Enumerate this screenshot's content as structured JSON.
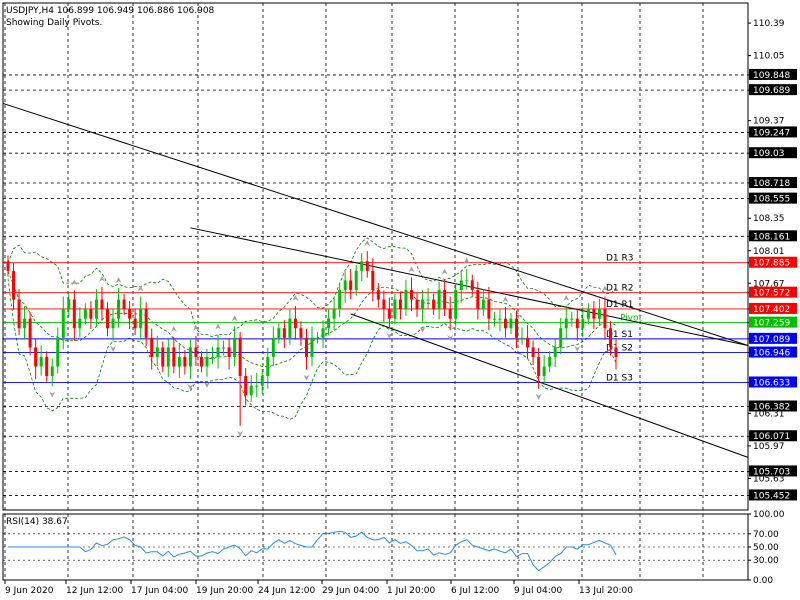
{
  "header": {
    "line1": "USDJPY,H4  106.899 106.949 106.886 106.908",
    "line2": "Showing Daily Pivots."
  },
  "rsi": {
    "label": "RSI(14) 38.67"
  },
  "colors": {
    "bull": "#00c000",
    "bear": "#ff0000",
    "resistance": "#ff0000",
    "support": "#0000ff",
    "pivot": "#00c000",
    "grid": "#000000",
    "channel": "#000000",
    "bands": "#008000",
    "rsi_line": "#1e90ff",
    "fractal": "#a0a0a0",
    "axis_highlight_bg": "#ff0000",
    "axis_support_bg": "#0000ff",
    "axis_pivot_bg": "#00c000"
  },
  "chart_data": [
    {
      "type": "candlestick",
      "symbol": "USDJPY",
      "timeframe": "H4",
      "ylim": [
        105.3,
        110.6
      ],
      "x_ticks": [
        "9 Jun 2020",
        "12 Jun 12:00",
        "17 Jun 04:00",
        "19 Jun 20:00",
        "24 Jun 12:00",
        "29 Jun 04:00",
        "1 Jul 20:00",
        "6 Jul 12:00",
        "9 Jul 04:00",
        "13 Jul 20:00"
      ],
      "y_ticks": [
        110.39,
        110.05,
        109.848,
        109.689,
        109.37,
        109.247,
        109.03,
        108.718,
        108.555,
        108.35,
        108.161,
        108.01,
        107.885,
        107.67,
        107.572,
        107.402,
        107.259,
        107.089,
        106.946,
        106.633,
        106.382,
        106.31,
        106.071,
        105.97,
        105.703,
        105.63,
        105.452
      ],
      "pivots": [
        {
          "name": "D1 R3",
          "value": 107.885,
          "kind": "resistance"
        },
        {
          "name": "D1 R2",
          "value": 107.572,
          "kind": "resistance"
        },
        {
          "name": "D1 R1",
          "value": 107.402,
          "kind": "resistance"
        },
        {
          "name": "Pivot",
          "value": 107.259,
          "kind": "pivot"
        },
        {
          "name": "D1 S1",
          "value": 107.089,
          "kind": "support"
        },
        {
          "name": "D1 S2",
          "value": 106.946,
          "kind": "support"
        },
        {
          "name": "D1 S3",
          "value": 106.633,
          "kind": "support"
        }
      ],
      "close_series": [
        107.8,
        107.5,
        107.2,
        107.3,
        107.0,
        106.8,
        106.9,
        106.7,
        106.8,
        107.1,
        107.4,
        107.5,
        107.2,
        107.3,
        107.4,
        107.3,
        107.5,
        107.4,
        107.2,
        107.3,
        107.5,
        107.4,
        107.3,
        107.2,
        107.4,
        107.1,
        106.9,
        107.0,
        106.8,
        107.0,
        106.8,
        106.9,
        106.8,
        107.0,
        106.9,
        106.8,
        106.9,
        106.9,
        107.0,
        107.0,
        106.9,
        107.1,
        106.7,
        106.5,
        106.6,
        106.6,
        106.7,
        106.9,
        107.1,
        107.2,
        107.1,
        107.3,
        107.2,
        107.1,
        106.9,
        107.1,
        107.1,
        107.2,
        107.3,
        107.4,
        107.6,
        107.7,
        107.6,
        107.8,
        107.9,
        107.8,
        107.6,
        107.5,
        107.4,
        107.3,
        107.5,
        107.4,
        107.6,
        107.5,
        107.4,
        107.5,
        107.5,
        107.4,
        107.6,
        107.4,
        107.3,
        107.6,
        107.7,
        107.7,
        107.6,
        107.4,
        107.5,
        107.3,
        107.3,
        107.3,
        107.2,
        107.3,
        107.1,
        107.1,
        107.0,
        106.9,
        106.7,
        106.8,
        106.9,
        107.0,
        107.2,
        107.3,
        107.3,
        107.2,
        107.3,
        107.4,
        107.3,
        107.4,
        107.2,
        107.0,
        106.9
      ],
      "rsi_ylim": [
        0,
        100
      ],
      "rsi_ticks": [
        100.0,
        70.0,
        50.0,
        30.0,
        0.0
      ],
      "rsi_ticks_text": [
        "100.00",
        "70.00",
        "50.00",
        "30.00",
        "0.00"
      ]
    }
  ]
}
